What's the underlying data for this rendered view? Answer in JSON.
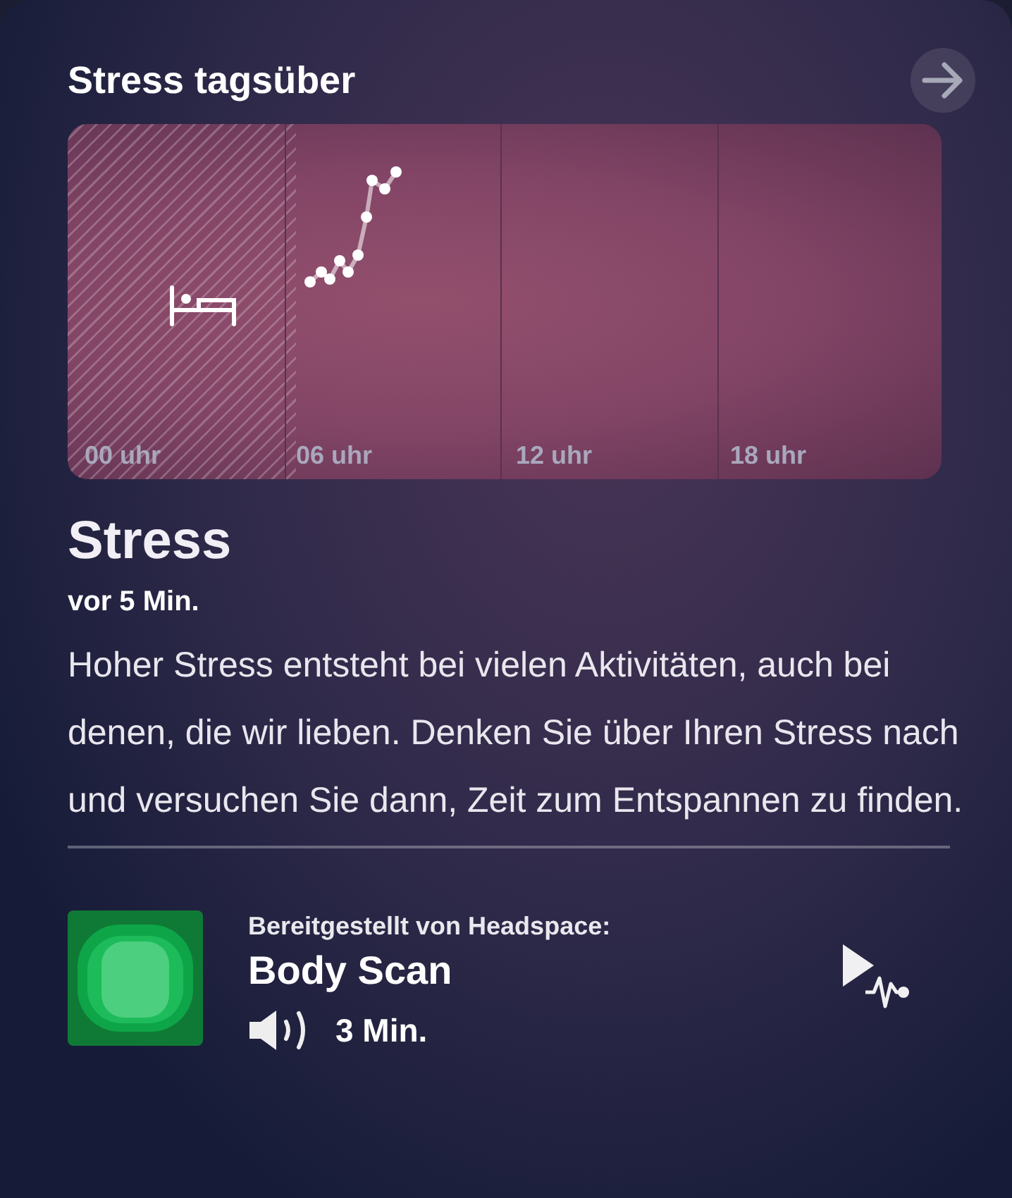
{
  "header": {
    "title": "Stress tagsüber"
  },
  "chart": {
    "time_labels": [
      "00 uhr",
      "06 uhr",
      "12 uhr",
      "18 uhr"
    ]
  },
  "stress": {
    "heading": "Stress",
    "time": "vor 5 Min.",
    "description": "Hoher Stress entsteht bei vielen Aktivitäten, auch bei denen, die wir lieben. Denken Sie über Ihren Stress nach und versuchen Sie dann, Zeit zum Entspannen zu finden."
  },
  "recommendation": {
    "provider": "Bereitgestellt von Headspace:",
    "title": "Body Scan",
    "duration": "3 Min."
  }
}
